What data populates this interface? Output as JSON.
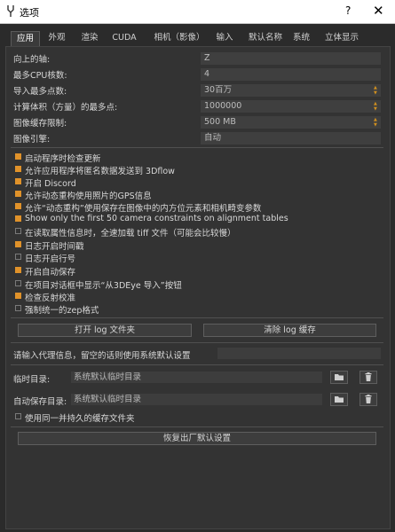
{
  "window": {
    "title": "选项",
    "help": "?",
    "close": "✕"
  },
  "tabs": [
    {
      "label": "应用"
    },
    {
      "label": "外观"
    },
    {
      "label": "渲染"
    },
    {
      "label": "CUDA"
    },
    {
      "label": "相机（影像）"
    },
    {
      "label": "输入"
    },
    {
      "label": "默认名称"
    },
    {
      "label": "系统"
    },
    {
      "label": "立体显示"
    }
  ],
  "settings": [
    {
      "label": "向上的轴:",
      "value": "Z"
    },
    {
      "label": "最多CPU核数:",
      "value": "4"
    },
    {
      "label": "导入最多点数:",
      "value": "30百万"
    },
    {
      "label": "计算体积（方量）的最多点:",
      "value": "1000000"
    },
    {
      "label": "图像缓存限制:",
      "value": "500 MB"
    },
    {
      "label": "图像引擎:",
      "value": "自动"
    }
  ],
  "checkboxes": [
    {
      "label": "启动程序时检查更新",
      "checked": true
    },
    {
      "label": "允许应用程序将匿名数据发送到 3Dflow",
      "checked": true
    },
    {
      "label": "开启 Discord",
      "checked": true
    },
    {
      "label": "允许动态重构使用照片的GPS信息",
      "checked": true
    },
    {
      "label": "允许“动态重构”使用保存在图像中的内方位元素和相机畸变参数",
      "checked": true
    },
    {
      "label": "Show only the first 50 camera constraints on alignment tables",
      "checked": true
    },
    {
      "label": "在读取属性信息时，全速加载 tiff 文件（可能会比较慢）",
      "checked": false
    },
    {
      "label": "日志开启时间戳",
      "checked": true
    },
    {
      "label": "日志开启行号",
      "checked": false
    },
    {
      "label": "开启自动保存",
      "checked": true
    },
    {
      "label": "在项目对话框中显示“从3DEye 导入”按钮",
      "checked": false
    },
    {
      "label": "检查反射校准",
      "checked": true
    },
    {
      "label": "强制统一的zep格式",
      "checked": false
    }
  ],
  "buttons": {
    "open_log": "打开 log 文件夹",
    "clear_log": "清除 log 缓存",
    "restore_defaults": "恢复出厂默认设置"
  },
  "proxy": {
    "label": "请输入代理信息，留空的话则使用系统默认设置",
    "value": ""
  },
  "dirs": {
    "temp_label": "临时目录:",
    "temp_value": "系统默认临时目录",
    "autosave_label": "自动保存目录:",
    "autosave_value": "系统默认临时目录"
  },
  "use_same_cache": {
    "label": "使用同一并持久的缓存文件夹",
    "checked": false
  },
  "colors": {
    "accent": "#e0922a",
    "background": "#2b2b2b",
    "panel": "#333333"
  }
}
